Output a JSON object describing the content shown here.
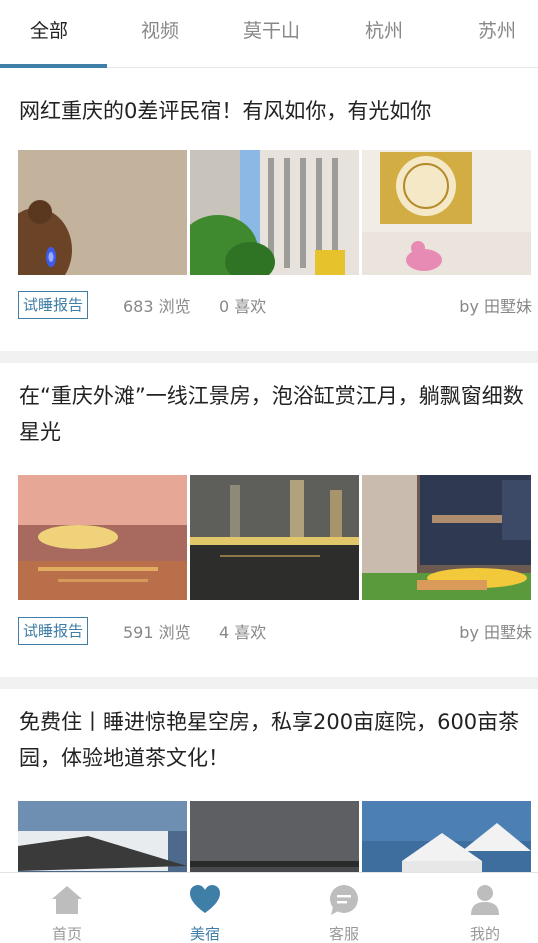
{
  "tabs": [
    {
      "label": "全部",
      "active": true
    },
    {
      "label": "视频",
      "active": false
    },
    {
      "label": "莫干山",
      "active": false
    },
    {
      "label": "杭州",
      "active": false
    },
    {
      "label": "苏州",
      "active": false
    }
  ],
  "articles": [
    {
      "title": "网红重庆的0差评民宿！有风如你，有光如你",
      "tag": "试睡报告",
      "views": "683 浏览",
      "likes": "0 喜欢",
      "author": "by 田墅妹"
    },
    {
      "title": "在“重庆外滩”一线江景房，泡浴缸赏江月，躺飘窗细数星光",
      "tag": "试睡报告",
      "views": "591 浏览",
      "likes": "4 喜欢",
      "author": "by 田墅妹"
    },
    {
      "title": "免费住丨睡进惊艳星空房，私享200亩庭院，600亩茶园，体验地道茶文化！"
    }
  ],
  "bottom_nav": [
    {
      "label": "首页",
      "icon": "home-icon",
      "active": false
    },
    {
      "label": "美宿",
      "icon": "heart-icon",
      "active": true
    },
    {
      "label": "客服",
      "icon": "chat-icon",
      "active": false
    },
    {
      "label": "我的",
      "icon": "user-icon",
      "active": false
    }
  ],
  "colors": {
    "accent": "#3f7ea6",
    "muted": "#888888",
    "divider": "#f1f1f1"
  }
}
